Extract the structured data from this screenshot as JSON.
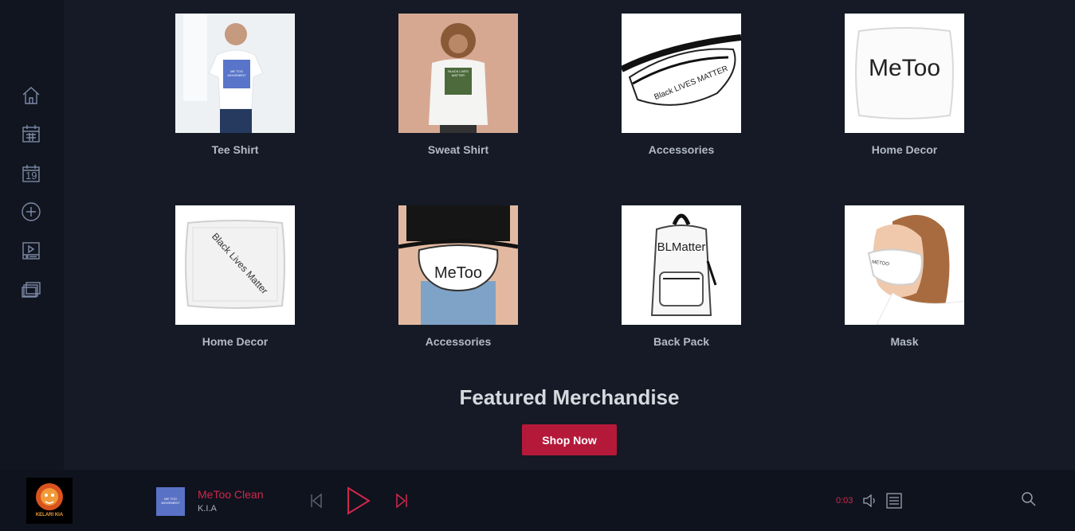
{
  "sidebar": {
    "items": [
      {
        "name": "home-icon"
      },
      {
        "name": "calendar-icon"
      },
      {
        "name": "date-icon",
        "day": "19"
      },
      {
        "name": "add-circle-icon"
      },
      {
        "name": "video-playlist-icon"
      },
      {
        "name": "albums-icon"
      }
    ]
  },
  "products": [
    {
      "label": "Tee Shirt",
      "thumb_text": "ME TOO MOVEMENT"
    },
    {
      "label": "Sweat Shirt",
      "thumb_text": "BLACK LIVES MATTER"
    },
    {
      "label": "Accessories",
      "thumb_text": "Black LIVES MATTER"
    },
    {
      "label": "Home Decor",
      "thumb_text": "MeToo"
    },
    {
      "label": "Home Decor",
      "thumb_text": "Black Lives Matter"
    },
    {
      "label": "Accessories",
      "thumb_text": "MeToo"
    },
    {
      "label": "Back Pack",
      "thumb_text": "BLMatter"
    },
    {
      "label": "Mask",
      "thumb_text": "METOO"
    }
  ],
  "featured": {
    "title": "Featured Merchandise",
    "button_label": "Shop Now"
  },
  "player": {
    "logo_text": "KELARI KIA",
    "track_art_text": "ME TOO MOVEMENT",
    "track_title": "MeToo Clean",
    "artist": "K.I.A",
    "time": "0:03"
  },
  "colors": {
    "accent": "#b5193a",
    "track_title": "#d0274a",
    "background": "#151a26"
  }
}
